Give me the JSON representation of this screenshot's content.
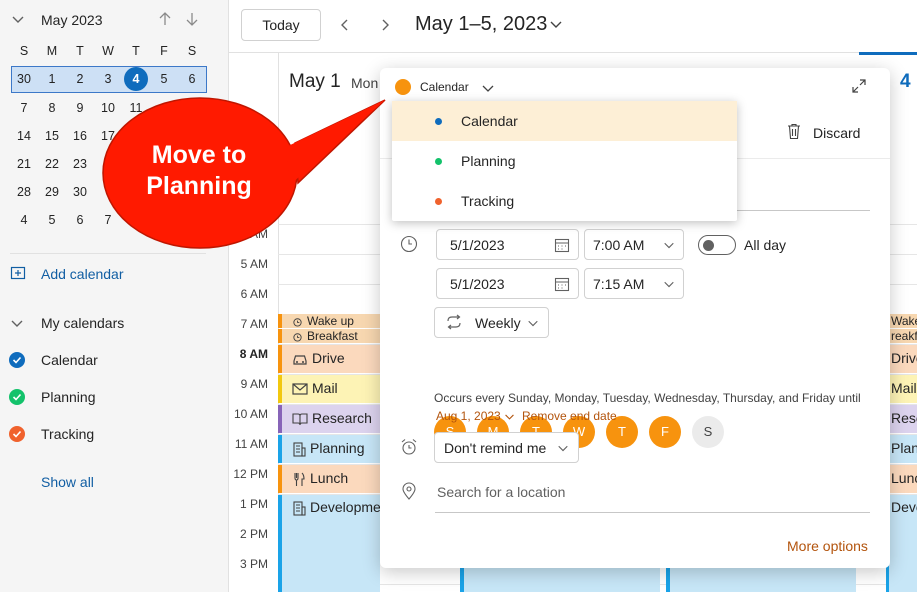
{
  "mini_calendar": {
    "month_title": "May 2023",
    "weekdays": [
      "S",
      "M",
      "T",
      "W",
      "T",
      "F",
      "S"
    ],
    "weeks": [
      [
        "30",
        "1",
        "2",
        "3",
        "4",
        "5",
        "6"
      ],
      [
        "7",
        "8",
        "9",
        "10",
        "11",
        "",
        ""
      ],
      [
        "14",
        "15",
        "16",
        "17",
        "",
        "",
        ""
      ],
      [
        "21",
        "22",
        "23",
        "",
        "",
        "",
        ""
      ],
      [
        "28",
        "29",
        "30",
        "",
        "",
        "",
        ""
      ],
      [
        "4",
        "5",
        "6",
        "7",
        "",
        "",
        ""
      ]
    ]
  },
  "sidebar": {
    "add_calendar": "Add calendar",
    "my_calendars": "My calendars",
    "calendars": [
      {
        "label": "Calendar",
        "color": "#0f6cbd"
      },
      {
        "label": "Planning",
        "color": "#13a10e"
      },
      {
        "label": "Tracking",
        "color": "#ca5010"
      }
    ],
    "show_all": "Show all"
  },
  "header": {
    "today": "Today",
    "range": "May 1–5, 2023",
    "day_col_1": "May 1",
    "day_col_1_weekday": "Mon",
    "day_col_5": "4"
  },
  "hours": [
    "4 AM",
    "5 AM",
    "6 AM",
    "7 AM",
    "8 AM",
    "9 AM",
    "10 AM",
    "11 AM",
    "12 PM",
    "1 PM",
    "2 PM",
    "3 PM"
  ],
  "events": [
    {
      "label": "Wake up",
      "color": "#f7d7b0"
    },
    {
      "label": "Breakfast",
      "color": "#f7d7b0"
    },
    {
      "label": "Drive",
      "color": "#fbd9bd"
    },
    {
      "label": "Mail",
      "color": "#fdf3b5"
    },
    {
      "label": "Research",
      "color": "#dcd3ee"
    },
    {
      "label": "Planning",
      "color": "#c7e6f7"
    },
    {
      "label": "Lunch",
      "color": "#fbd9bd"
    },
    {
      "label": "Development",
      "color": "#c7e6f7"
    }
  ],
  "right_events": [
    "Wake",
    "reakf",
    "Drive",
    "Mail",
    "Rese",
    "Plann",
    "Lunc",
    "Deve"
  ],
  "popup": {
    "calendar_selector": "Calendar",
    "discard": "Discard",
    "start_date": "5/1/2023",
    "start_time": "7:00 AM",
    "all_day": "All day",
    "end_date": "5/1/2023",
    "end_time": "7:15 AM",
    "recurrence": "Weekly",
    "days": [
      "S",
      "M",
      "T",
      "W",
      "T",
      "F",
      "S"
    ],
    "recurrence_summary": "Occurs every Sunday, Monday, Tuesday, Wednesday, Thursday, and Friday until",
    "until_date": "Aug 1, 2023",
    "remove_end_date": "Remove end date",
    "reminder": "Don't remind me",
    "location_placeholder": "Search for a location",
    "more_options": "More options"
  },
  "dropdown": {
    "items": [
      {
        "label": "Calendar",
        "color": "#0f6cbd"
      },
      {
        "label": "Planning",
        "color": "#13c26b"
      },
      {
        "label": "Tracking",
        "color": "#f0622d"
      }
    ]
  },
  "callout": {
    "line1": "Move to",
    "line2": "Planning"
  }
}
